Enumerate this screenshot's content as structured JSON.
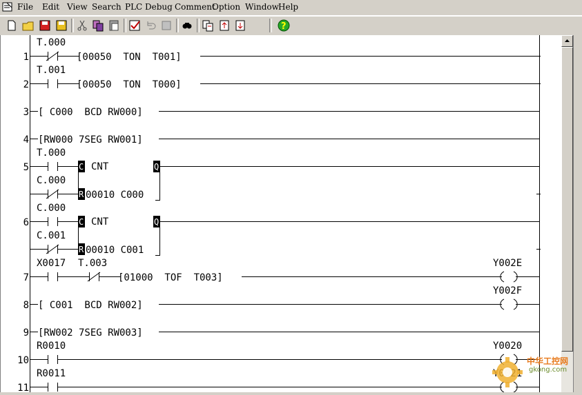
{
  "menu": [
    "File",
    "Edit",
    "View",
    "Search",
    "PLC",
    "Debug",
    "Comment",
    "Option",
    "Window",
    "Help"
  ],
  "toolbar": [
    "new-icon",
    "open-icon",
    "save-red-icon",
    "save-icon",
    "cut-icon",
    "copy-icon",
    "paste-icon",
    "check-icon",
    "undo-icon",
    "redo-icon",
    "find-icon",
    "copy-block-icon",
    "import-icon",
    "export-icon",
    "help-icon"
  ],
  "rung_numbers": [
    "1",
    "2",
    "3",
    "4",
    "5",
    "6",
    "7",
    "8",
    "9",
    "10",
    "11"
  ],
  "ladder": {
    "r1_contact": "T.000",
    "r1_instr": "[00050  TON  T001]",
    "r2_contact": "T.001",
    "r2_instr": "[00050  TON  T000]",
    "r3_instr": "[ C000  BCD RW000]",
    "r4_instr": "[RW000 7SEG RW001]",
    "r5_contact_a": "T.000",
    "r5_cnt": "CNT",
    "r5_c": "C",
    "r5_q": "Q",
    "r5_contact_b": "C.000",
    "r5_r": "R",
    "r5_params": "00010 C000",
    "r6_contact_a": "C.000",
    "r6_cnt": "CNT",
    "r6_c": "C",
    "r6_q": "Q",
    "r6_contact_b": "C.001",
    "r6_r": "R",
    "r6_params": "00010 C001",
    "r7_contact_a": "X0017",
    "r7_contact_b": "T.003",
    "r7_instr": "[01000  TOF  T003]",
    "r7_coil": "Y002E",
    "r8_instr": "[ C001  BCD RW002]",
    "r8_coil": "Y002F",
    "r9_instr": "[RW002 7SEG RW003]",
    "r10_contact": "R0010",
    "r10_coil": "Y0020",
    "r11_contact": "R0011",
    "r11_coil": "Y0021"
  },
  "watermark": {
    "line1": "中华工控网",
    "line2": "gkong.com"
  }
}
